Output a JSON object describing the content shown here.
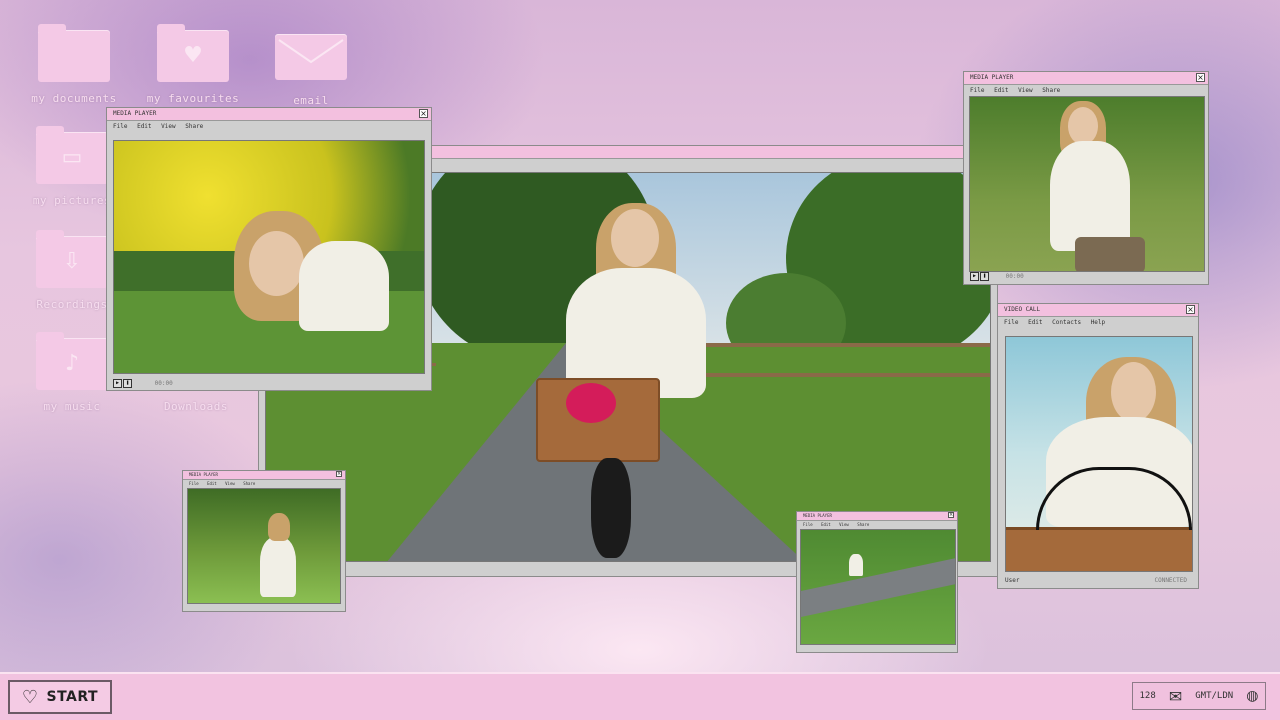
{
  "desktop_icons": [
    {
      "label": "my documents",
      "icon": "folder-icon"
    },
    {
      "label": "my favourites",
      "icon": "heart-folder-icon"
    },
    {
      "label": "email",
      "icon": "envelope-icon"
    },
    {
      "label": "my pictures",
      "icon": "image-folder-icon"
    },
    {
      "label": "Recordings",
      "icon": "download-folder-icon"
    },
    {
      "label": "my music",
      "icon": "music-folder-icon"
    },
    {
      "label": "Downloads",
      "icon": "folder-icon"
    }
  ],
  "windows": {
    "media_player_left": {
      "title": "MEDIA PLAYER",
      "menu": [
        "File",
        "Edit",
        "View",
        "Share"
      ],
      "status": "00:00"
    },
    "main_video": {
      "title": ""
    },
    "media_player_right": {
      "title": "MEDIA PLAYER",
      "menu": [
        "File",
        "Edit",
        "View",
        "Share"
      ],
      "status": "00:00"
    },
    "video_call": {
      "title": "VIDEO CALL",
      "menu": [
        "File",
        "Edit",
        "Contacts",
        "Help"
      ],
      "status_left": "User",
      "status_right": "CONNECTED"
    },
    "small_player_left": {
      "title": "MEDIA PLAYER",
      "menu": [
        "File",
        "Edit",
        "View",
        "Share"
      ]
    },
    "small_player_right": {
      "title": "MEDIA PLAYER",
      "menu": [
        "File",
        "Edit",
        "View",
        "Share"
      ]
    }
  },
  "taskbar": {
    "start_label": "START",
    "tray_count": "128",
    "tray_timezone": "GMT/LDN"
  },
  "colors": {
    "titlebar": "#f3c0df",
    "window_chrome": "#cfcfcf",
    "taskbar": "#f2c3e0"
  }
}
